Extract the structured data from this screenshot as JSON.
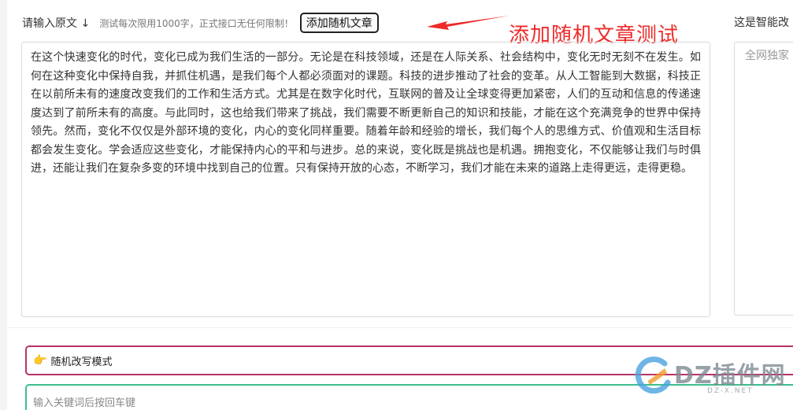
{
  "left_panel": {
    "label": "请输入原文 ↓",
    "hint": "测试每次限用1000字，正式接口无任何限制！",
    "random_button_label": "添加随机文章",
    "annotation": "添加随机文章测试",
    "source_text": "在这个快速变化的时代，变化已成为我们生活的一部分。无论是在科技领域，还是在人际关系、社会结构中，变化无时无刻不在发生。如何在这种变化中保持自我，并抓住机遇，是我们每个人都必须面对的课题。科技的进步推动了社会的变革。从人工智能到大数据，科技正在以前所未有的速度改变我们的工作和生活方式。尤其是在数字化时代，互联网的普及让全球变得更加紧密，人们的互动和信息的传递速度达到了前所未有的高度。与此同时，这也给我们带来了挑战，我们需要不断更新自己的知识和技能，才能在这个充满竞争的世界中保持领先。然而，变化不仅仅是外部环境的变化，内心的变化同样重要。随着年龄和经验的增长，我们每个人的思维方式、价值观和生活目标都会发生变化。学会适应这些变化，才能保持内心的平和与进步。总的来说，变化既是挑战也是机遇。拥抱变化，不仅能够让我们与时俱进，还能让我们在复杂多变的环境中找到自己的位置。只有保持开放的心态，不断学习，我们才能在未来的道路上走得更远，走得更稳。"
  },
  "right_panel": {
    "label": "这是智能改",
    "placeholder": "全网独家"
  },
  "mode_bar": {
    "icon": "pointing-hand-icon",
    "label": "随机改写模式"
  },
  "keyword_bar": {
    "placeholder": "输入关键词后按回车键"
  },
  "watermark": {
    "brand": "DZ插件网",
    "sub": "DZ-X.NET"
  },
  "colors": {
    "annotation": "#ee2a2a",
    "mode_border": "#b8336a",
    "keyword_border": "#3bbf8c",
    "logo_blue": "#4aa3e0",
    "logo_orange": "#f29a2e"
  }
}
